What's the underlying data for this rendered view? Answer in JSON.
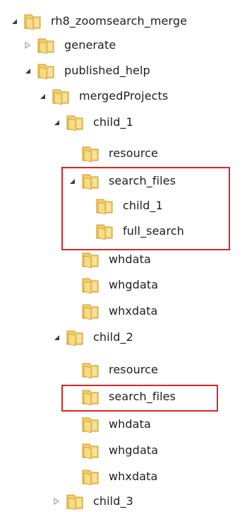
{
  "tree": {
    "nodes": [
      {
        "label": "rh8_zoomsearch_merge",
        "depth": 0,
        "state": "expanded"
      },
      {
        "label": "generate",
        "depth": 1,
        "state": "collapsed"
      },
      {
        "label": "published_help",
        "depth": 1,
        "state": "expanded"
      },
      {
        "label": "mergedProjects",
        "depth": 2,
        "state": "expanded"
      },
      {
        "label": "child_1",
        "depth": 3,
        "state": "expanded"
      },
      {
        "label": "resource",
        "depth": 4,
        "state": "leaf"
      },
      {
        "label": "search_files",
        "depth": 4,
        "state": "expanded"
      },
      {
        "label": "child_1",
        "depth": 5,
        "state": "leaf"
      },
      {
        "label": "full_search",
        "depth": 5,
        "state": "leaf"
      },
      {
        "label": "whdata",
        "depth": 4,
        "state": "leaf"
      },
      {
        "label": "whgdata",
        "depth": 4,
        "state": "leaf"
      },
      {
        "label": "whxdata",
        "depth": 4,
        "state": "leaf"
      },
      {
        "label": "child_2",
        "depth": 3,
        "state": "expanded"
      },
      {
        "label": "resource",
        "depth": 4,
        "state": "leaf"
      },
      {
        "label": "search_files",
        "depth": 4,
        "state": "leaf"
      },
      {
        "label": "whdata",
        "depth": 4,
        "state": "leaf"
      },
      {
        "label": "whgdata",
        "depth": 4,
        "state": "leaf"
      },
      {
        "label": "whxdata",
        "depth": 4,
        "state": "leaf"
      },
      {
        "label": "child_3",
        "depth": 3,
        "state": "collapsed"
      }
    ]
  },
  "colors": {
    "highlight_border": "#d9252b",
    "folder_body": "#f3cf6b",
    "folder_front": "#f8dc83",
    "folder_edge": "#c89a2a",
    "toggle_expanded": "#3d3d3d",
    "toggle_collapsed": "#a0a0a0"
  },
  "icons": {
    "folder": "folder-icon",
    "expanded": "expanded-arrow-icon",
    "collapsed": "collapsed-arrow-icon"
  }
}
